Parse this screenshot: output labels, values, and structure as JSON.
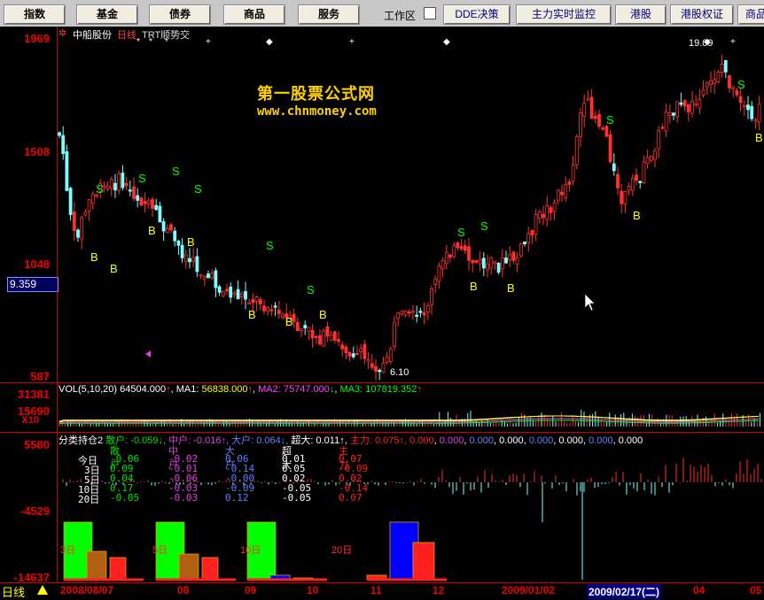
{
  "menu": {
    "items": [
      "指数",
      "基金",
      "债券",
      "商品",
      "服务"
    ],
    "workzone": "工作区",
    "right_items": [
      "DDE决策",
      "主力实时监控",
      "港股",
      "港股权证",
      "商品"
    ]
  },
  "main_chart": {
    "stock_name": "中船股份",
    "period": "日线",
    "indicator": "TRT顺势交",
    "watermark_title": "第一股票公式网",
    "watermark_url": "www.chnmoney.com",
    "y_labels": [
      "1969",
      "1508",
      "1048",
      "587"
    ],
    "current_value": "9.359",
    "high_label": "19.09",
    "low_label": "6.10",
    "signal_buy": "B",
    "signal_sell": "S"
  },
  "volume": {
    "title": "VOL(5,10,20)",
    "value": "64504.000",
    "ma1_label": "MA1:",
    "ma1": "56838.000",
    "ma2_label": "MA2:",
    "ma2": "75747.000",
    "ma3_label": "MA3:",
    "ma3": "107819.352",
    "y_labels": [
      "31381",
      "15690"
    ],
    "unit": "X10"
  },
  "holding": {
    "title": "分类持仓2",
    "legend": [
      {
        "name": "散户:",
        "value": "-0.059",
        "color": "#00e000"
      },
      {
        "name": "中户:",
        "value": "-0.016",
        "color": "#e040e0"
      },
      {
        "name": "大户:",
        "value": "0.064",
        "color": "#6080ff"
      },
      {
        "name": "超大:",
        "value": "0.011",
        "color": "#ffffff"
      },
      {
        "name": "主力:",
        "value": "0.075",
        "color": "#ff2020"
      }
    ],
    "extra_values": [
      "0.000",
      "0.000",
      "0.000",
      "0.000",
      "0.000",
      "0.000",
      "0.000",
      "0.000"
    ],
    "y_labels": [
      "5580",
      "-4529",
      "-14637"
    ],
    "table_headers": [
      "散户",
      "中户",
      "大户",
      "超大",
      "主力"
    ],
    "table_rows": [
      {
        "label": "今日",
        "values": [
          "-0.06",
          "-0.02",
          "0.06",
          "0.01",
          "0.07"
        ]
      },
      {
        "label": "3日",
        "values": [
          "0.09",
          "-0.01",
          "-0.14",
          "0.05",
          "-0.09"
        ]
      },
      {
        "label": "5日",
        "values": [
          "0.04",
          "-0.06",
          "-0.00",
          "0.02",
          "0.02"
        ]
      },
      {
        "label": "10日",
        "values": [
          "0.17",
          "-0.03",
          "-0.09",
          "-0.05",
          "-0.14"
        ]
      },
      {
        "label": "20日",
        "values": [
          "-0.05",
          "-0.03",
          "0.12",
          "-0.05",
          "0.07"
        ]
      }
    ],
    "group_labels": [
      "3日",
      "5日",
      "10日",
      "20日"
    ]
  },
  "bottom": {
    "period": "日线",
    "dates": [
      "2008/08/07",
      "08",
      "09",
      "10",
      "11",
      "12",
      "2009/01/02",
      "2009/02/17(二)",
      "04",
      "05"
    ]
  }
}
